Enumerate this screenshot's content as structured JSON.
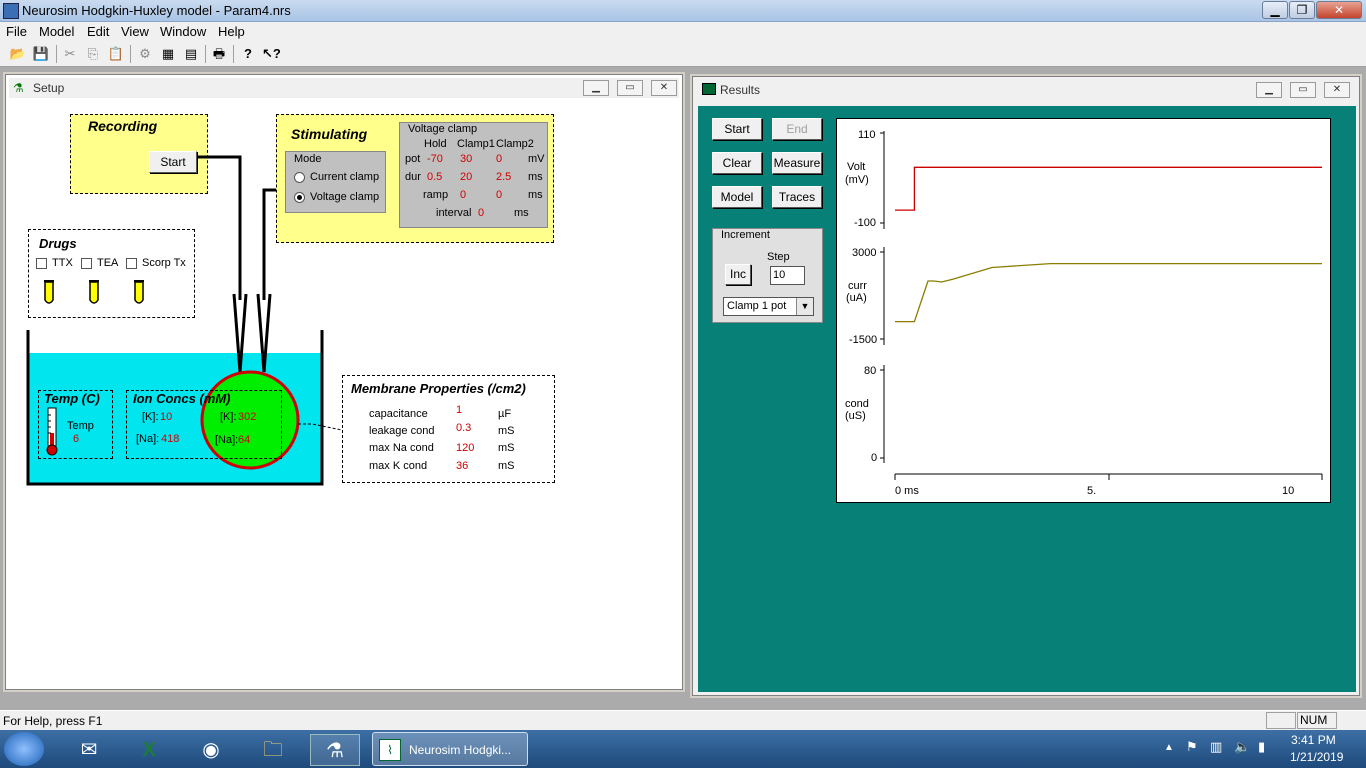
{
  "app": {
    "title": "Neurosim Hodgkin-Huxley model - Param4.nrs"
  },
  "menu": {
    "file": "File",
    "model": "Model",
    "edit": "Edit",
    "view": "View",
    "window": "Window",
    "help": "Help"
  },
  "toolbar": {
    "icons": [
      "open-icon",
      "save-icon",
      "cut-icon",
      "copy-icon",
      "paste-icon",
      "setup-icon",
      "grid-icon",
      "list-icon",
      "print-icon",
      "help-icon",
      "context-help-icon"
    ]
  },
  "setup": {
    "title": "Setup",
    "recording": {
      "title": "Recording",
      "start": "Start"
    },
    "stimulating": {
      "title": "Stimulating",
      "mode": {
        "title": "Mode",
        "current": "Current clamp",
        "voltage": "Voltage clamp",
        "selected": "voltage"
      },
      "vclamp": {
        "title": "Voltage clamp",
        "hold_h": "Hold",
        "c1_h": "Clamp1",
        "c2_h": "Clamp2",
        "pot_label": "pot",
        "pot_hold": "-70",
        "pot_c1": "30",
        "pot_c2": "0",
        "pot_unit": "mV",
        "dur_label": "dur",
        "dur_hold": "0.5",
        "dur_c1": "20",
        "dur_c2": "2.5",
        "dur_unit": "ms",
        "ramp_label": "ramp",
        "ramp_c1": "0",
        "ramp_c2": "0",
        "ramp_unit": "ms",
        "interval_label": "interval",
        "interval_val": "0",
        "interval_unit": "ms"
      }
    },
    "drugs": {
      "title": "Drugs",
      "ttx": "TTX",
      "tea": "TEA",
      "scorp": "Scorp Tx"
    },
    "temp": {
      "title": "Temp (C)",
      "label": "Temp",
      "value": "6"
    },
    "ion": {
      "title": "Ion Concs (mM)",
      "k_out_label": "[K]:",
      "k_out": "10",
      "na_out_label": "[Na]:",
      "na_out": "418",
      "k_in_label": "[K]:",
      "k_in": "302",
      "na_in_label": "[Na]:",
      "na_in": "64"
    },
    "membrane": {
      "title": "Membrane Properties (/cm2)",
      "rows": [
        {
          "label": "capacitance",
          "value": "1",
          "unit": "µF"
        },
        {
          "label": "leakage cond",
          "value": "0.3",
          "unit": "mS"
        },
        {
          "label": "max Na cond",
          "value": "120",
          "unit": "mS"
        },
        {
          "label": "max K cond",
          "value": "36",
          "unit": "mS"
        }
      ]
    }
  },
  "results": {
    "title": "Results",
    "buttons": {
      "start": "Start",
      "end": "End",
      "clear": "Clear",
      "measure": "Measure",
      "model": "Model",
      "traces": "Traces"
    },
    "increment": {
      "title": "Increment",
      "step_label": "Step",
      "step_value": "10",
      "inc": "Inc",
      "dropdown": "Clamp 1 pot"
    },
    "chart_data": {
      "type": "line",
      "volt": {
        "label": "Volt",
        "unit": "(mV)",
        "ymax": "110",
        "ymin": "-100"
      },
      "curr": {
        "label": "curr",
        "unit": "(uA)",
        "ymax": "3000",
        "ymin": "-1500"
      },
      "cond": {
        "label": "cond",
        "unit": "(uS)",
        "ymax": "80",
        "ymin": "0"
      },
      "x_ticks": [
        "0 ms",
        "5.",
        "10"
      ],
      "series": [
        {
          "color": "#cc0000",
          "x": [
            0,
            0.5,
            0.5,
            11
          ],
          "y": [
            -70,
            -70,
            30,
            30
          ]
        },
        {
          "color": "#8b7d00",
          "x": [
            0,
            0.5,
            0.85,
            1.0,
            1.2,
            1.5,
            2.5,
            4,
            11
          ],
          "y": [
            -600,
            -600,
            1500,
            1500,
            1450,
            1600,
            2200,
            2400,
            2400
          ]
        }
      ]
    }
  },
  "status": {
    "help": "For Help, press F1",
    "num": "NUM"
  },
  "taskbar": {
    "active_task": "Neurosim Hodgki...",
    "time": "3:41 PM",
    "date": "1/21/2019"
  }
}
